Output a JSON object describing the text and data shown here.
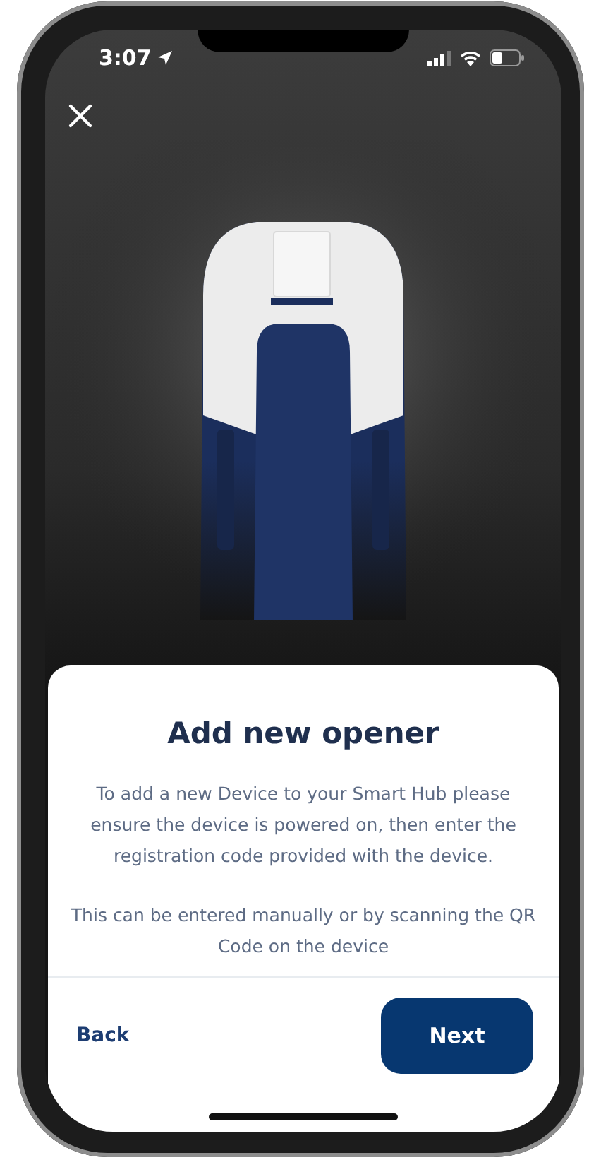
{
  "status_bar": {
    "time": "3:07"
  },
  "sheet": {
    "title": "Add new opener",
    "paragraphs": [
      "To add a new Device to your Smart Hub please ensure the device is powered on, then enter the registration code provided with the device.",
      "This can be entered manually or by scanning the QR Code on the device"
    ]
  },
  "footer": {
    "back": "Back",
    "next": "Next"
  }
}
